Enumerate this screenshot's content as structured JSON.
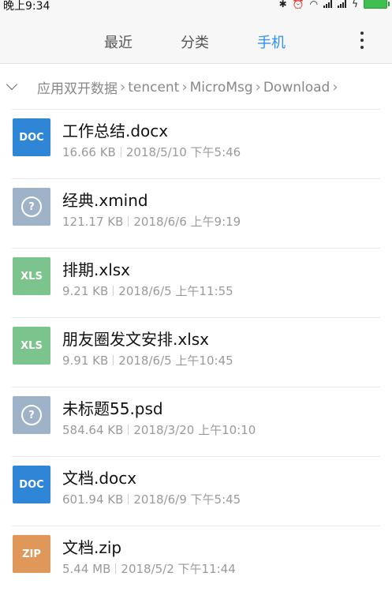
{
  "status_bar": {
    "time": "晚上9:34",
    "icons": [
      "bluetooth-icon",
      "alarm-icon",
      "wifi-icon",
      "signal-icon",
      "signal-icon",
      "charging-icon",
      "battery-icon"
    ]
  },
  "tabs": [
    {
      "label": "最近",
      "active": false
    },
    {
      "label": "分类",
      "active": false
    },
    {
      "label": "手机",
      "active": true
    }
  ],
  "colors": {
    "accent": "#2c8ef8",
    "doc": "#2f86d6",
    "xls": "#7cc48e",
    "unknown": "#9fb3c8",
    "zip": "#e0985a"
  },
  "breadcrumb": {
    "items": [
      "应用双开数据",
      "tencent",
      "MicroMsg",
      "Download"
    ]
  },
  "files": [
    {
      "icon_type": "doc",
      "icon_label": "DOC",
      "name": "工作总结.docx",
      "size": "16.66 KB",
      "date": "2018/5/10 下午5:46"
    },
    {
      "icon_type": "unknown",
      "icon_label": "?",
      "name": "经典.xmind",
      "size": "121.17 KB",
      "date": "2018/6/6 上午9:19"
    },
    {
      "icon_type": "xls",
      "icon_label": "XLS",
      "name": "排期.xlsx",
      "size": "9.21 KB",
      "date": "2018/6/5 上午11:55"
    },
    {
      "icon_type": "xls",
      "icon_label": "XLS",
      "name": "朋友圈发文安排.xlsx",
      "size": "9.91 KB",
      "date": "2018/6/5 上午10:45"
    },
    {
      "icon_type": "unknown",
      "icon_label": "?",
      "name": "未标题55.psd",
      "size": "584.64 KB",
      "date": "2018/3/20 上午10:10"
    },
    {
      "icon_type": "doc",
      "icon_label": "DOC",
      "name": "文档.docx",
      "size": "601.94 KB",
      "date": "2018/6/9 下午5:45"
    },
    {
      "icon_type": "zip",
      "icon_label": "ZIP",
      "name": "文档.zip",
      "size": "5.44 MB",
      "date": "2018/5/2 下午11:44"
    }
  ]
}
